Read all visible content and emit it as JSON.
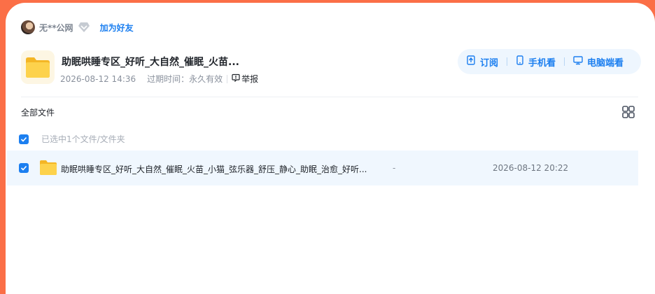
{
  "sharer": {
    "name": "无**公网",
    "add_friend_label": "加为好友"
  },
  "share": {
    "title": "助眠哄睡专区_好听_大自然_催眠_火苗...",
    "created": "2026-08-12 14:36",
    "expire_label": "过期时间：",
    "expire_value": "永久有效",
    "report_label": "举报"
  },
  "actions": {
    "subscribe_label": "订阅",
    "mobile_label": "手机看",
    "pc_label": "电脑端看"
  },
  "breadcrumb": {
    "root_label": "全部文件"
  },
  "selection": {
    "text": "已选中1个文件/文件夹",
    "all_checked": true
  },
  "files": [
    {
      "name": "助眠哄睡专区_好听_大自然_催眠_火苗_小猫_弦乐器_舒压_静心_助眠_治愈_好听...",
      "size": "-",
      "date": "2026-08-12 20:22",
      "checked": true
    }
  ],
  "colors": {
    "frame": "#fb6f47",
    "accent": "#1c7ff0",
    "folder": "#f9c93a",
    "row_highlight": "#f0f7fe"
  },
  "icons": {
    "vip": "diamond-badge-icon",
    "report": "alert-bubble-icon",
    "subscribe": "bookmark-plus-icon",
    "mobile": "phone-icon",
    "pc": "monitor-icon",
    "grid_view": "grid-view-icon",
    "folder": "folder-icon"
  }
}
